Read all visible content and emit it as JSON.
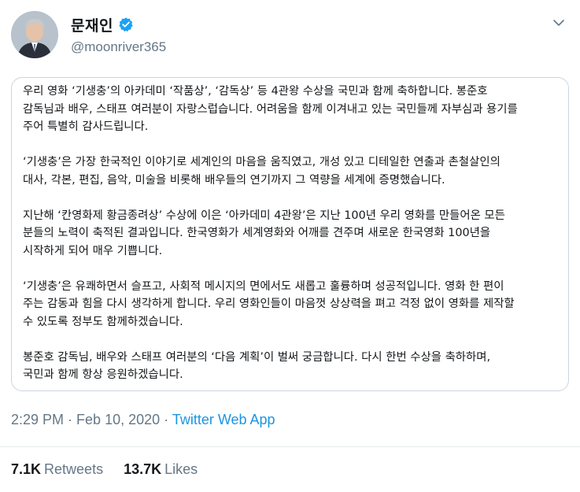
{
  "user": {
    "display_name": "문재인",
    "handle": "@moonriver365",
    "verified": true,
    "avatar_icon": "user-avatar-portrait"
  },
  "tweet": {
    "paragraphs": [
      "우리 영화 ‘기생충’의 아카데미 ‘작품상’, ‘감독상’ 등 4관왕 수상을 국민과 함께 축하합니다. 봉준호\n감독님과 배우, 스태프 여러분이 자랑스럽습니다. 어려움을 함께 이겨내고 있는 국민들께 자부심과 용기를\n주어 특별히 감사드립니다.",
      "‘기생충’은 가장 한국적인 이야기로 세계인의 마음을 움직였고, 개성 있고 디테일한 연출과 촌철살인의\n대사, 각본, 편집, 음악, 미술을 비롯해 배우들의 연기까지 그 역량을 세계에 증명했습니다.",
      "지난해 ‘칸영화제 황금종려상’ 수상에 이은 ‘아카데미 4관왕’은 지난 100년 우리 영화를 만들어온 모든\n분들의 노력이 축적된 결과입니다. 한국영화가 세계영화와 어깨를 견주며 새로운 한국영화 100년을\n시작하게 되어 매우 기쁩니다.",
      "‘기생충’은 유쾌하면서 슬프고, 사회적 메시지의 면에서도 새롭고 훌륭하며 성공적입니다. 영화 한 편이\n주는 감동과 힘을 다시 생각하게 합니다. 우리 영화인들이 마음껏 상상력을 펴고 걱정 없이 영화를 제작할\n수 있도록 정부도 함께하겠습니다.",
      "봉준호 감독님, 배우와 스태프 여러분의 ‘다음 계획’이 벌써 궁금합니다. 다시 한번 수상을 축하하며,\n국민과 함께 항상 응원하겠습니다."
    ]
  },
  "meta": {
    "time": "2:29 PM",
    "separator": " · ",
    "date": "Feb 10, 2020",
    "source": "Twitter Web App"
  },
  "stats": {
    "retweets_count": "7.1K",
    "retweets_label": "Retweets",
    "likes_count": "13.7K",
    "likes_label": "Likes"
  },
  "colors": {
    "accent": "#1b95e0",
    "verified": "#1da1f2",
    "muted_text": "#657786",
    "border": "#ccd6dd"
  }
}
